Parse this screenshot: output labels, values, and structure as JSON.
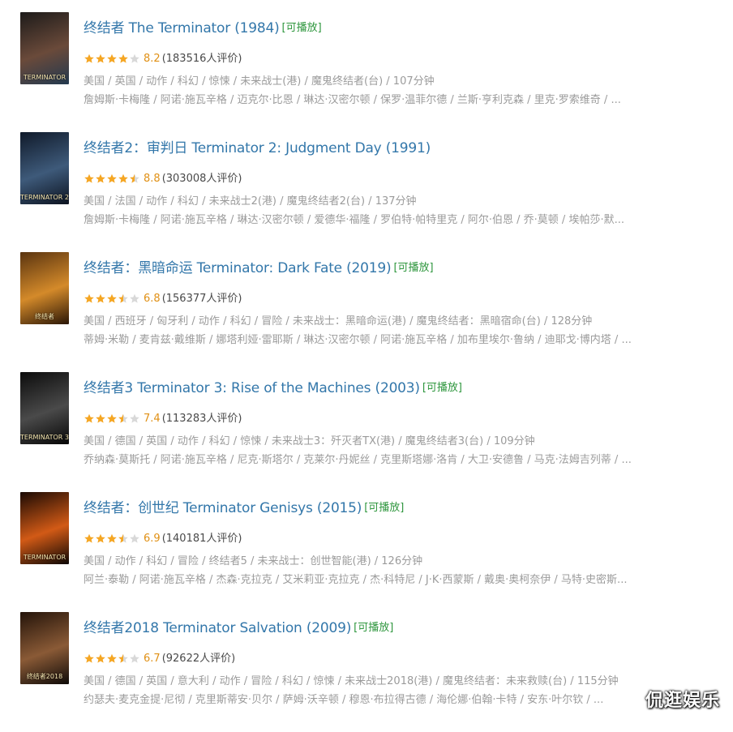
{
  "items": [
    {
      "title": "终结者 The Terminator (1984)",
      "playable": "[可播放]",
      "stars": 4,
      "half": false,
      "score": "8.2",
      "count": "(183516人评价)",
      "meta": "美国 / 英国 / 动作 / 科幻 / 惊悚 / 未来战士(港) / 魔鬼终结者(台) / 107分钟",
      "cast": "詹姆斯·卡梅隆 / 阿诺·施瓦辛格 / 迈克尔·比恩 / 琳达·汉密尔顿 / 保罗·温菲尔德 / 兰斯·亨利克森 / 里克·罗索维奇 / ...",
      "poster_colors": [
        "#1d1b1a",
        "#6a4a3a",
        "#23394f"
      ],
      "poster_tag": "TERMINATOR"
    },
    {
      "title": "终结者2：审判日 Terminator 2: Judgment Day (1991)",
      "playable": "",
      "stars": 4,
      "half": true,
      "score": "8.8",
      "count": "(303008人评价)",
      "meta": "美国 / 法国 / 动作 / 科幻 / 未来战士2(港) / 魔鬼终结者2(台) / 137分钟",
      "cast": "詹姆斯·卡梅隆 / 阿诺·施瓦辛格 / 琳达·汉密尔顿 / 爱德华·福隆 / 罗伯特·帕特里克 / 阿尔·伯恩 / 乔·莫顿 / 埃帕莎·默...",
      "poster_colors": [
        "#101a2a",
        "#3e5a7a",
        "#0c1320"
      ],
      "poster_tag": "TERMINATOR 2"
    },
    {
      "title": "终结者：黑暗命运 Terminator: Dark Fate (2019)",
      "playable": "[可播放]",
      "stars": 3,
      "half": true,
      "score": "6.8",
      "count": "(156377人评价)",
      "meta": "美国 / 西班牙 / 匈牙利 / 动作 / 科幻 / 冒险 / 未来战士：黑暗命运(港) / 魔鬼终结者：黑暗宿命(台) / 128分钟",
      "cast": "蒂姆·米勒 / 麦肯兹·戴维斯 / 娜塔利娅·雷耶斯 / 琳达·汉密尔顿 / 阿诺·施瓦辛格 / 加布里埃尔·鲁纳 / 迪耶戈·博内塔 / ...",
      "poster_colors": [
        "#5a3410",
        "#d48a2a",
        "#2a1606"
      ],
      "poster_tag": "终结者"
    },
    {
      "title": "终结者3 Terminator 3: Rise of the Machines (2003)",
      "playable": "[可播放]",
      "stars": 3,
      "half": true,
      "score": "7.4",
      "count": "(113283人评价)",
      "meta": "美国 / 德国 / 英国 / 动作 / 科幻 / 惊悚 / 未来战士3：歼灭者TX(港) / 魔鬼终结者3(台) / 109分钟",
      "cast": "乔纳森·莫斯托 / 阿诺·施瓦辛格 / 尼克·斯塔尔 / 克莱尔·丹妮丝 / 克里斯塔娜·洛肯 / 大卫·安德鲁 / 马克·法姆吉列蒂 / ...",
      "poster_colors": [
        "#0c0c0c",
        "#4a4a4a",
        "#060606"
      ],
      "poster_tag": "TERMINATOR 3"
    },
    {
      "title": "终结者：创世纪 Terminator Genisys (2015)",
      "playable": "[可播放]",
      "stars": 3,
      "half": true,
      "score": "6.9",
      "count": "(140181人评价)",
      "meta": "美国 / 动作 / 科幻 / 冒险 / 终结者5 / 未来战士：创世智能(港) / 126分钟",
      "cast": "阿兰·泰勒 / 阿诺·施瓦辛格 / 杰森·克拉克 / 艾米莉亚·克拉克 / 杰·科特尼 / J·K·西蒙斯 / 戴奥·奥柯奈伊 / 马特·史密斯...",
      "poster_colors": [
        "#1a0a04",
        "#d25a16",
        "#0c0604"
      ],
      "poster_tag": "TERMINATOR"
    },
    {
      "title": "终结者2018 Terminator Salvation (2009)",
      "playable": "[可播放]",
      "stars": 3,
      "half": true,
      "score": "6.7",
      "count": "(92622人评价)",
      "meta": "美国 / 德国 / 英国 / 意大利 / 动作 / 冒险 / 科幻 / 惊悚 / 未来战士2018(港) / 魔鬼终结者：未来救赎(台) / 115分钟",
      "cast": "约瑟夫·麦克金提·尼彻 / 克里斯蒂安·贝尔 / 萨姆·沃辛顿 / 穆恩·布拉得古德 / 海伦娜·伯翰·卡特 / 安东·叶尔钦 / ...",
      "poster_colors": [
        "#24140a",
        "#8a5a36",
        "#0e0a08"
      ],
      "poster_tag": "终结者2018"
    }
  ],
  "watermark": "侃逛娱乐",
  "colors": {
    "title": "#3377aa",
    "playable": "#2e963d",
    "score": "#e09015",
    "star_on": "#f5a623",
    "star_off": "#d8d8d8",
    "meta": "#9b9b9b"
  }
}
